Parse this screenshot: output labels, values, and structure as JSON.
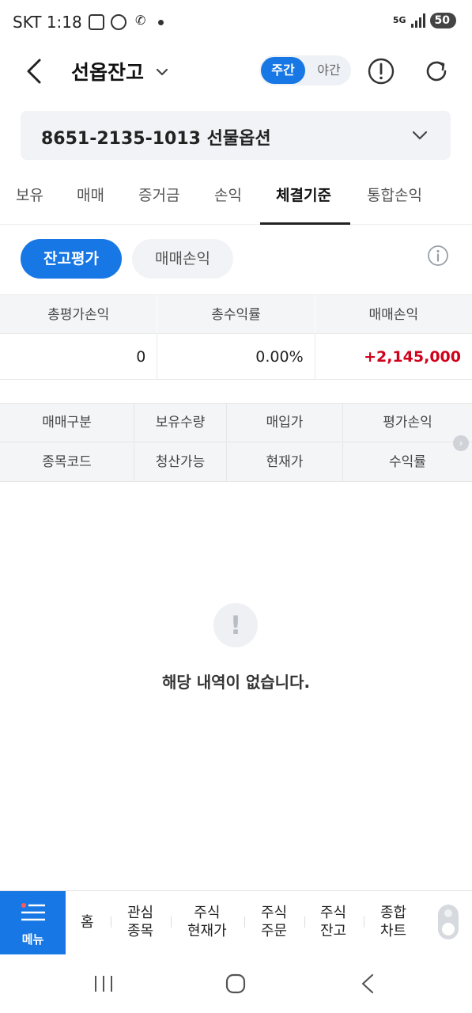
{
  "status_bar": {
    "carrier_time": "SKT 1:18",
    "network": "5G",
    "battery": "50"
  },
  "header": {
    "title": "선옵잔고",
    "session_day": "주간",
    "session_night": "야간"
  },
  "account": {
    "label": "8651-2135-1013 선물옵션"
  },
  "tabs": [
    "보유",
    "매매",
    "증거금",
    "손익",
    "체결기준",
    "통합손익"
  ],
  "active_tab": "체결기준",
  "sub_toggle": {
    "primary": "잔고평가",
    "secondary": "매매손익"
  },
  "summary": {
    "headers": [
      "총평가손익",
      "총수익률",
      "매매손익"
    ],
    "values": [
      "0",
      "0.00%",
      "+2,145,000"
    ]
  },
  "holdings_header": {
    "row1": [
      "매매구분",
      "보유수량",
      "매입가",
      "평가손익"
    ],
    "row2": [
      "종목코드",
      "청산가능",
      "현재가",
      "수익률"
    ]
  },
  "empty_state": {
    "message": "해당 내역이 없습니다."
  },
  "bottom_nav": {
    "menu": "메뉴",
    "home": "홈",
    "watch_1": "관심",
    "watch_2": "종목",
    "price_1": "주식",
    "price_2": "현재가",
    "order_1": "주식",
    "order_2": "주문",
    "balance_1": "주식",
    "balance_2": "잔고",
    "chart_1": "종합",
    "chart_2": "차트"
  },
  "colors": {
    "accent": "#1677e5",
    "positive": "#d0021b"
  }
}
